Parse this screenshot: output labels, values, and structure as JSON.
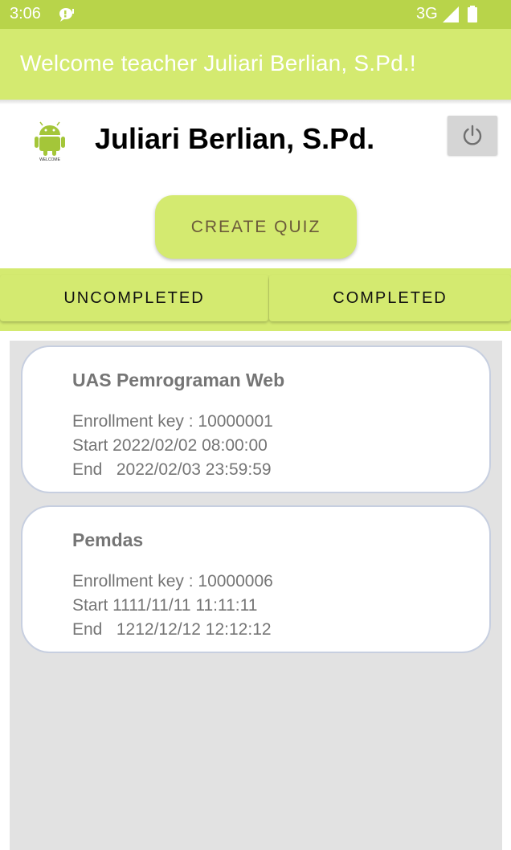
{
  "status_bar": {
    "time": "3:06",
    "network": "3G",
    "icons": [
      "notification-icon",
      "signal-icon",
      "battery-icon"
    ]
  },
  "app_bar": {
    "title": "Welcome teacher Juliari Berlian, S.Pd.!"
  },
  "profile": {
    "logo_text": "WELCOME",
    "name": "Juliari Berlian, S.Pd.",
    "logout_icon": "power-icon"
  },
  "actions": {
    "create_quiz_label": "CREATE QUIZ"
  },
  "tabs": [
    {
      "label": "UNCOMPLETED"
    },
    {
      "label": "COMPLETED"
    }
  ],
  "quizzes": [
    {
      "title": "UAS Pemrograman Web",
      "enrollment": "Enrollment key : 10000001",
      "start": "Start 2022/02/02 08:00:00",
      "end": "End   2022/02/03 23:59:59"
    },
    {
      "title": "Pemdas",
      "enrollment": "Enrollment key : 10000006",
      "start": "Start 1111/11/11 11:11:11",
      "end": "End   1212/12/12 12:12:12"
    }
  ],
  "colors": {
    "status_bar": "#b8d44a",
    "accent": "#d4ea70",
    "list_background": "#e2e2e2",
    "card_border": "#c7cfe0"
  }
}
